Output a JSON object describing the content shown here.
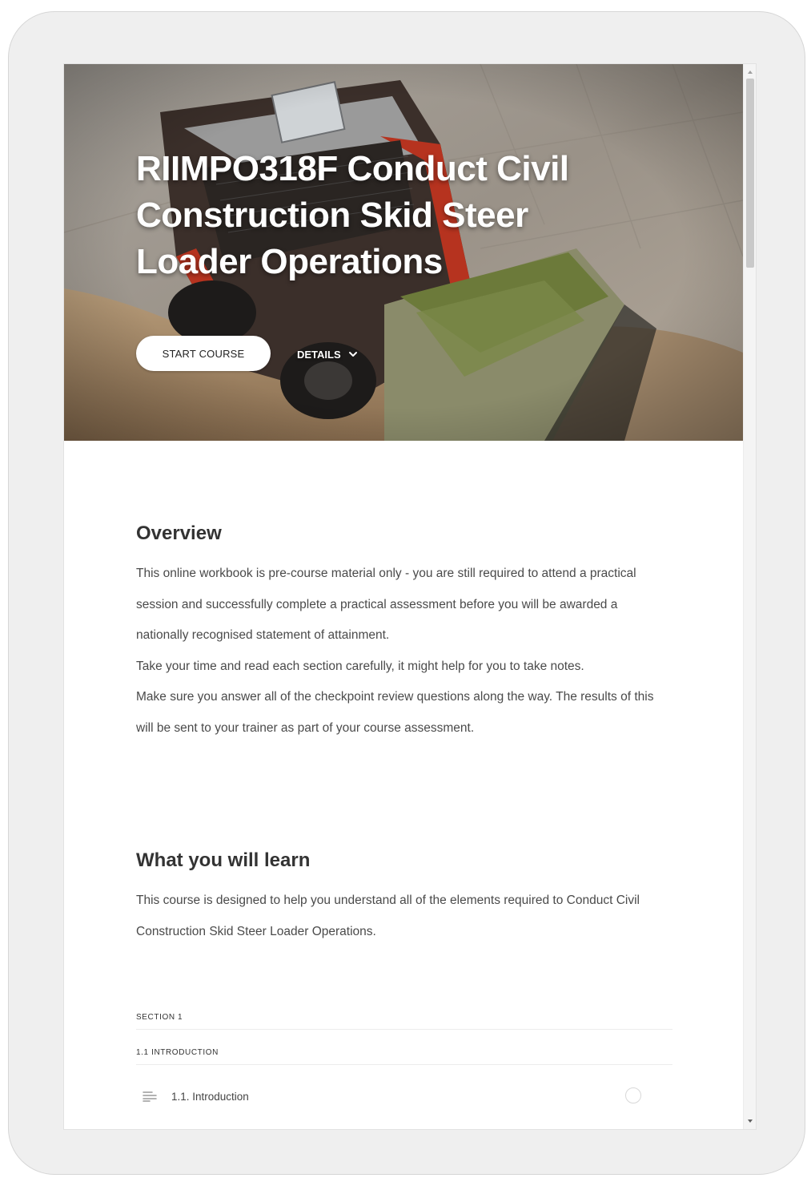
{
  "hero": {
    "title": "RIIMPO318F Conduct Civil Construction Skid Steer Loader Operations",
    "start_label": "START COURSE",
    "details_label": "DETAILS"
  },
  "overview": {
    "title": "Overview",
    "paragraph1": "This online workbook is pre-course material only - you are still required to attend a practical session and successfully complete a practical assessment before you will be awarded a nationally recognised statement of attainment.",
    "paragraph2": "Take your time and read each section carefully, it might help for you to take notes.",
    "paragraph3": "Make sure you answer all of the checkpoint review questions along the way. The results of this will be sent to your trainer as part of your course assessment."
  },
  "learn": {
    "title": "What you will learn",
    "paragraph": "This course is designed to help you understand all of the elements required to Conduct Civil Construction Skid Steer Loader Operations."
  },
  "outline": {
    "section_label": "SECTION 1",
    "subsection_label": "1.1 INTRODUCTION",
    "lessons": [
      {
        "label": "1.1. Introduction"
      }
    ]
  },
  "icons": {
    "details": "chevron-down-icon",
    "lesson": "text-lines-icon",
    "status": "circle-icon",
    "scroll_up": "arrow-up-icon",
    "scroll_down": "arrow-down-icon"
  }
}
